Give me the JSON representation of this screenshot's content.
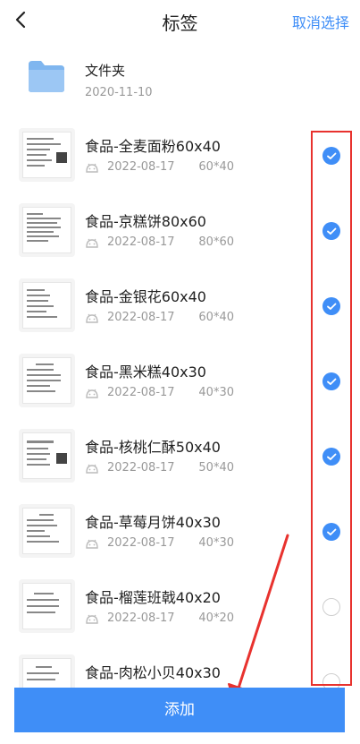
{
  "header": {
    "title": "标签",
    "cancel_label": "取消选择"
  },
  "folder": {
    "name": "文件夹",
    "date": "2020-11-10"
  },
  "items": [
    {
      "name": "食品-全麦面粉60x40",
      "date": "2022-08-17",
      "size": "60*40",
      "selected": true
    },
    {
      "name": "食品-京糕饼80x60",
      "date": "2022-08-17",
      "size": "80*60",
      "selected": true
    },
    {
      "name": "食品-金银花60x40",
      "date": "2022-08-17",
      "size": "60*40",
      "selected": true
    },
    {
      "name": "食品-黑米糕40x30",
      "date": "2022-08-17",
      "size": "40*30",
      "selected": true
    },
    {
      "name": "食品-核桃仁酥50x40",
      "date": "2022-08-17",
      "size": "50*40",
      "selected": true
    },
    {
      "name": "食品-草莓月饼40x30",
      "date": "2022-08-17",
      "size": "40*30",
      "selected": true
    },
    {
      "name": "食品-榴莲班戟40x20",
      "date": "2022-08-17",
      "size": "40*20",
      "selected": false
    },
    {
      "name": "食品-肉松小贝40x30",
      "date": "",
      "size": "",
      "selected": false
    }
  ],
  "footer": {
    "add_label": "添加"
  },
  "colors": {
    "accent": "#3f8ef7",
    "annotation": "#e8322e"
  },
  "icons": {
    "back": "chevron-left-icon",
    "folder": "folder-icon",
    "device": "android-icon",
    "check": "check-icon"
  }
}
